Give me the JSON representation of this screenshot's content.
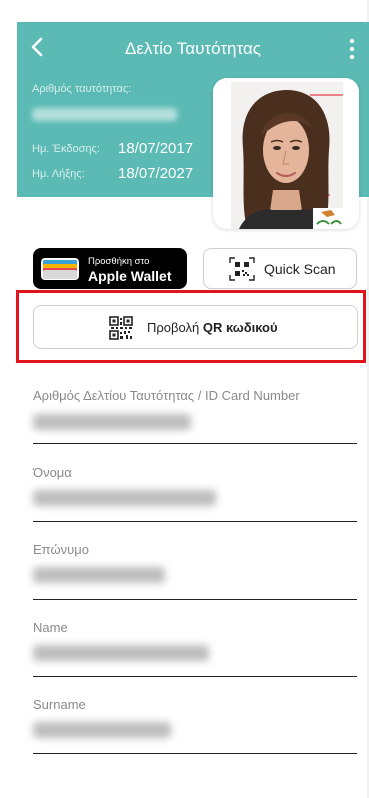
{
  "header": {
    "title": "Δελτίο Ταυτότητας",
    "id_number_label": "Αριθμός ταυτότητας:",
    "issue_label": "Ημ. Έκδοσης:",
    "issue_value": "18/07/2017",
    "expiry_label": "Ημ. Λήξης:",
    "expiry_value": "18/07/2027",
    "back_icon": "chevron-left-icon",
    "menu_icon": "more-vertical-icon",
    "color": "#5bbab4"
  },
  "actions": {
    "wallet_small": "Προσθήκη στο",
    "wallet_big": "Apple Wallet",
    "quick_scan": "Quick Scan",
    "qr_prefix": "Προβολή ",
    "qr_bold": "QR κωδικού",
    "highlight_color": "#e0141c"
  },
  "form": {
    "fields": [
      {
        "label": "Αριθμός Δελτίου Ταυτότητας / ID Card Number"
      },
      {
        "label": "Όνομα"
      },
      {
        "label": "Επώνυμο"
      },
      {
        "label": "Name"
      },
      {
        "label": "Surname"
      }
    ]
  }
}
